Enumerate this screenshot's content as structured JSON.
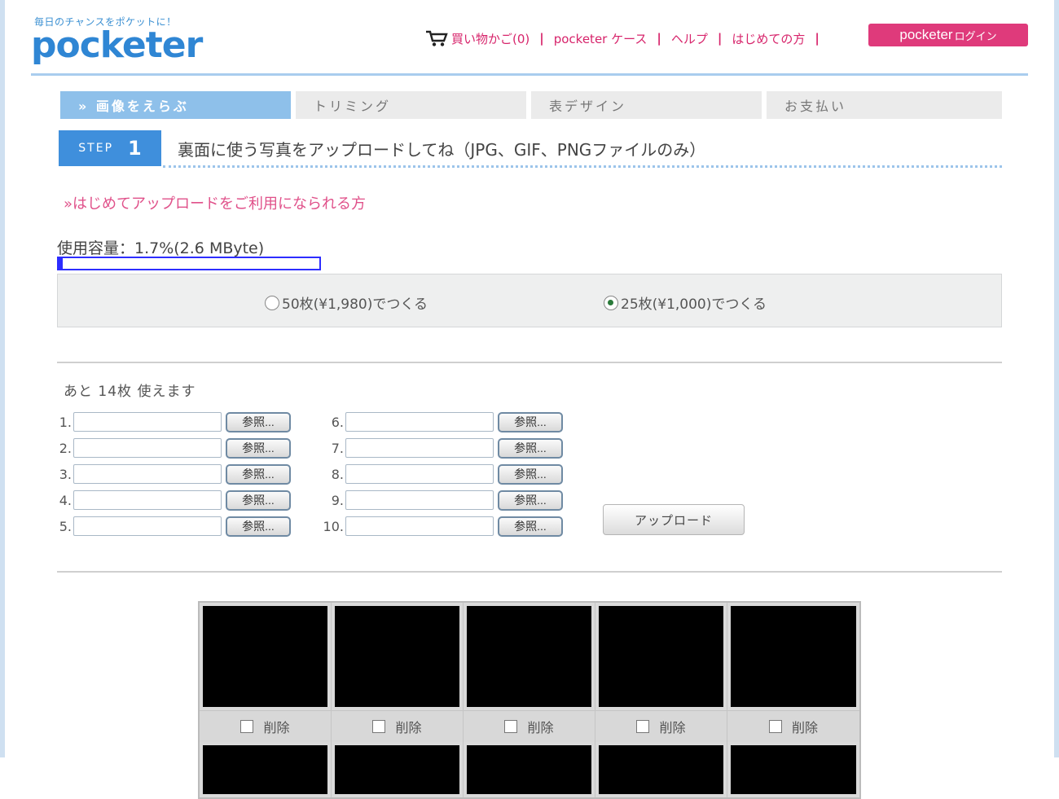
{
  "header": {
    "logo_tagline": "毎日のチャンスをポケットに！",
    "logo": "pocketer",
    "nav": [
      {
        "label": "買い物かご(0)"
      },
      {
        "label": "pocketer ケース"
      },
      {
        "label": "ヘルプ"
      },
      {
        "label": "はじめての方"
      }
    ],
    "separator": "|",
    "login": {
      "brand": "pocketer",
      "label": "ログイン"
    }
  },
  "steps": [
    {
      "label": "» 画像をえらぶ",
      "active": true
    },
    {
      "label": "トリミング",
      "active": false
    },
    {
      "label": "表デザイン",
      "active": false
    },
    {
      "label": "お支払い",
      "active": false
    }
  ],
  "step": {
    "badge_word": "STEP",
    "badge_number": "1",
    "title": "裏面に使う写真をアップロードしてね（JPG、GIF、PNGファイルのみ）"
  },
  "first_time_link": "»はじめてアップロードをご利用になられる方",
  "capacity": {
    "label": "使用容量：1.7%(2.6 MByte)",
    "percent": 1.7
  },
  "plans": [
    {
      "label": "50枚(¥1,980)でつくる",
      "selected": false
    },
    {
      "label": "25枚(¥1,000)でつくる",
      "selected": true
    }
  ],
  "remaining": "あと 14枚 使えます",
  "upload": {
    "browse_label": "参照...",
    "rows_left": [
      "1.",
      "2.",
      "3.",
      "4.",
      "5."
    ],
    "rows_right": [
      "6.",
      "7.",
      "8.",
      "9.",
      "10."
    ],
    "submit_label": "アップロード"
  },
  "thumbnails": {
    "delete_label": "削除",
    "count": 5
  },
  "colors": {
    "accent_blue": "#3f8fdc",
    "accent_pink": "#df3a7b",
    "active_tab": "#8ec0ea"
  }
}
